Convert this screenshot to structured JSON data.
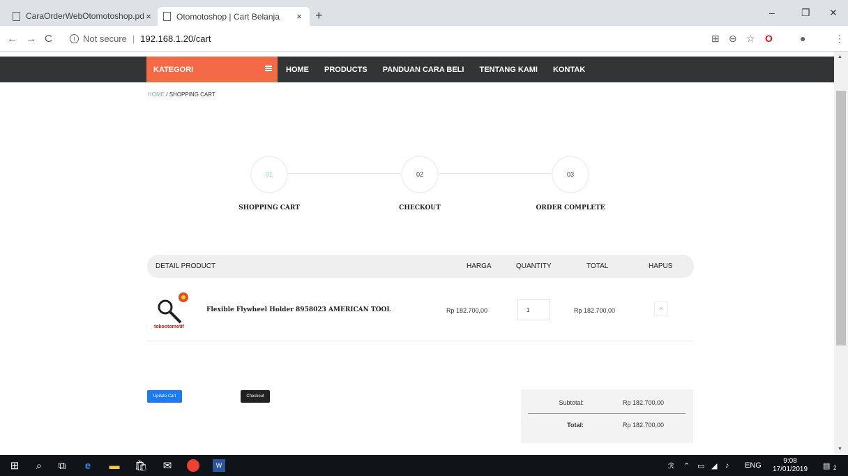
{
  "browser": {
    "tabs": [
      {
        "title": "CaraOrderWebOtomotoshop.pdf",
        "close": "×"
      },
      {
        "title": "Otomotoshop | Cart Belanja",
        "close": "×"
      }
    ],
    "new_tab": "+",
    "window_controls": {
      "minimize": "–",
      "restore": "❐",
      "close": "✕"
    },
    "nav": {
      "back": "←",
      "forward": "→",
      "reload": "C"
    },
    "address": {
      "security": "Not secure",
      "separator": "|",
      "url": "192.168.1.20/cart"
    },
    "toolbar_icons": [
      "translate-icon",
      "zoom-icon",
      "star-icon",
      "opera-icon",
      "profile-icon",
      "menu-icon"
    ]
  },
  "site": {
    "kategori_label": "KATEGORI",
    "nav_links": [
      "HOME",
      "PRODUCTS",
      "PANDUAN CARA BELI",
      "TENTANG KAMI",
      "KONTAK"
    ],
    "breadcrumb": {
      "home": "HOME",
      "sep": "/",
      "current": "SHOPPING CART"
    }
  },
  "steps": [
    {
      "num": "01",
      "label": "SHOPPING CART"
    },
    {
      "num": "02",
      "label": "CHECKOUT"
    },
    {
      "num": "03",
      "label": "ORDER COMPLETE"
    }
  ],
  "cart": {
    "headers": {
      "product": "DETAIL PRODUCT",
      "price": "HARGA",
      "quantity": "QUANTITY",
      "total": "TOTAL",
      "remove": "HAPUS"
    },
    "items": [
      {
        "name": "Flexible Flywheel Holder 8958023 AMERICAN TOOL",
        "price": "Rp 182.700,00",
        "quantity": "1",
        "total": "Rp 182.700,00",
        "remove": "×",
        "brand": "tokootomotif"
      }
    ],
    "update_label": "Update Cart",
    "checkout_label": "Checkout",
    "subtotal_label": "Subtotal:",
    "subtotal_value": "Rp 182.700,00",
    "total_label": "Total:",
    "total_value": "Rp 182.700,00"
  },
  "taskbar": {
    "language": "ENG",
    "time": "9:08",
    "date": "17/01/2019",
    "notifications": "2"
  },
  "colors": {
    "nav_bg": "#333436",
    "kategori_bg": "#f46a46",
    "update_btn": "#1a7bf2",
    "checkout_btn": "#222222",
    "step_active": "#8acfd0"
  }
}
